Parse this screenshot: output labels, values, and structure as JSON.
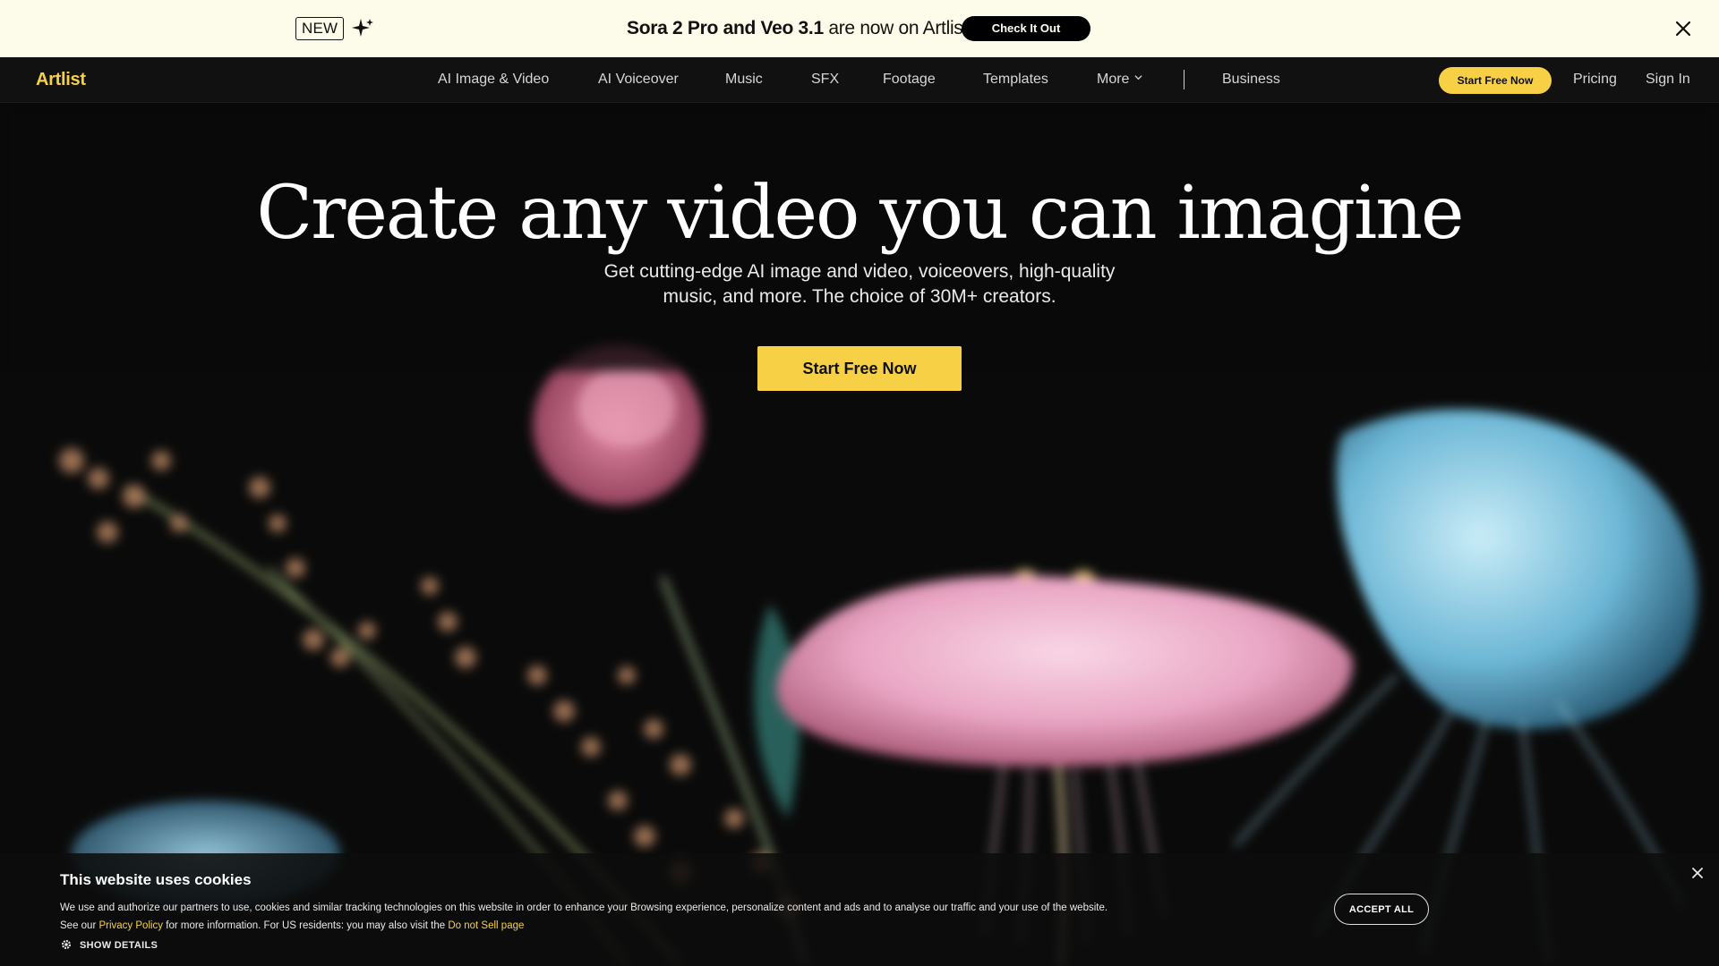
{
  "announcement": {
    "badge": "NEW",
    "text_strong": "Sora 2 Pro and Veo 3.1",
    "text_rest": " are now on Artlist!",
    "button": "Check It Out"
  },
  "nav": {
    "logo": "Artlist",
    "items": [
      {
        "label": "AI Image & Video"
      },
      {
        "label": "AI Voiceover"
      },
      {
        "label": "Music"
      },
      {
        "label": "SFX"
      },
      {
        "label": "Footage"
      },
      {
        "label": "Templates"
      },
      {
        "label": "More"
      },
      {
        "label": "Business"
      }
    ],
    "cta": "Start Free Now",
    "pricing": "Pricing",
    "signin": "Sign In"
  },
  "hero": {
    "headline": "Create any video you can imagine",
    "subhead_line1": "Get cutting-edge AI image and video, voiceovers, high-quality",
    "subhead_line2": "music, and more. The choice of 30M+ creators.",
    "cta": "Start Free Now"
  },
  "cookie": {
    "title": "This website uses cookies",
    "text_part1": "We use and authorize our partners to use, cookies and similar tracking technologies on this website in order to enhance your Browsing experience, personalize content and ads and to analyse our traffic and your use of the website. See our ",
    "privacy_link": "Privacy Policy",
    "text_part2": " for more information. For US residents: you may also visit the ",
    "dns_link": "Do not Sell page",
    "show_details": "SHOW DETAILS",
    "accept": "ACCEPT ALL"
  },
  "colors": {
    "accent": "#f7d046",
    "announce_bg": "#fdfbe9",
    "nav_bg": "#111111",
    "hero_bg": "#0a0a0a"
  }
}
